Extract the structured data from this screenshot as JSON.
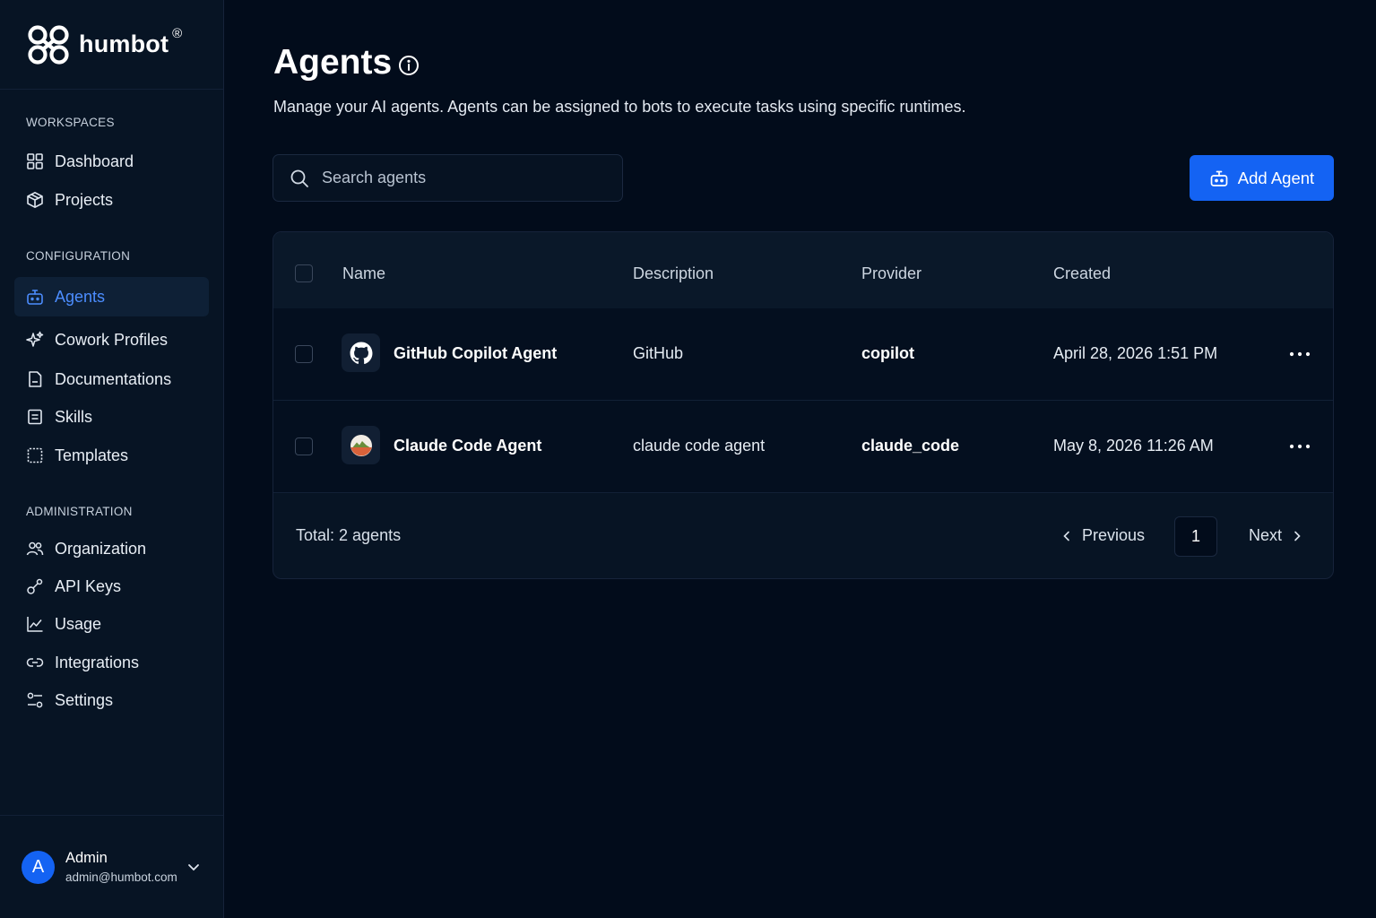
{
  "brand": {
    "name": "humbot",
    "reg": "®"
  },
  "sidebar": {
    "sections": [
      {
        "label": "WORKSPACES"
      },
      {
        "label": "CONFIGURATION"
      },
      {
        "label": "ADMINISTRATION"
      }
    ],
    "items": [
      {
        "label": "Dashboard",
        "icon": "grid-icon"
      },
      {
        "label": "Projects",
        "icon": "cube-icon"
      },
      {
        "label": "Agents",
        "icon": "bot-icon",
        "active": true
      },
      {
        "label": "Cowork Profiles",
        "icon": "sparkles-icon"
      },
      {
        "label": "Documentations",
        "icon": "document-icon"
      },
      {
        "label": "Skills",
        "icon": "list-icon"
      },
      {
        "label": "Templates",
        "icon": "template-icon"
      },
      {
        "label": "Organization",
        "icon": "users-icon"
      },
      {
        "label": "API Keys",
        "icon": "key-icon"
      },
      {
        "label": "Usage",
        "icon": "chart-icon"
      },
      {
        "label": "Integrations",
        "icon": "link-icon"
      },
      {
        "label": "Settings",
        "icon": "settings-icon"
      }
    ],
    "user": {
      "initial": "A",
      "name": "Admin",
      "email": "admin@humbot.com"
    }
  },
  "main": {
    "title": "Agents",
    "description": "Manage your AI agents. Agents can be assigned to bots to execute tasks using specific runtimes.",
    "search_placeholder": "Search agents",
    "add_button": "Add Agent",
    "accent": "#1463f3"
  },
  "table": {
    "columns": [
      "Name",
      "Description",
      "Provider",
      "Created"
    ],
    "rows": [
      {
        "name": "GitHub Copilot Agent",
        "description": "GitHub",
        "provider": "copilot",
        "created": "April 28, 2026 1:51 PM",
        "icon": "github-icon"
      },
      {
        "name": "Claude Code Agent",
        "description": "claude code agent",
        "provider": "claude_code",
        "created": "May 8, 2026 11:26 AM",
        "icon": "claude-logo-icon"
      }
    ],
    "total": "Total: 2 agents",
    "pagination": {
      "previous": "Previous",
      "page": "1",
      "next": "Next"
    }
  }
}
